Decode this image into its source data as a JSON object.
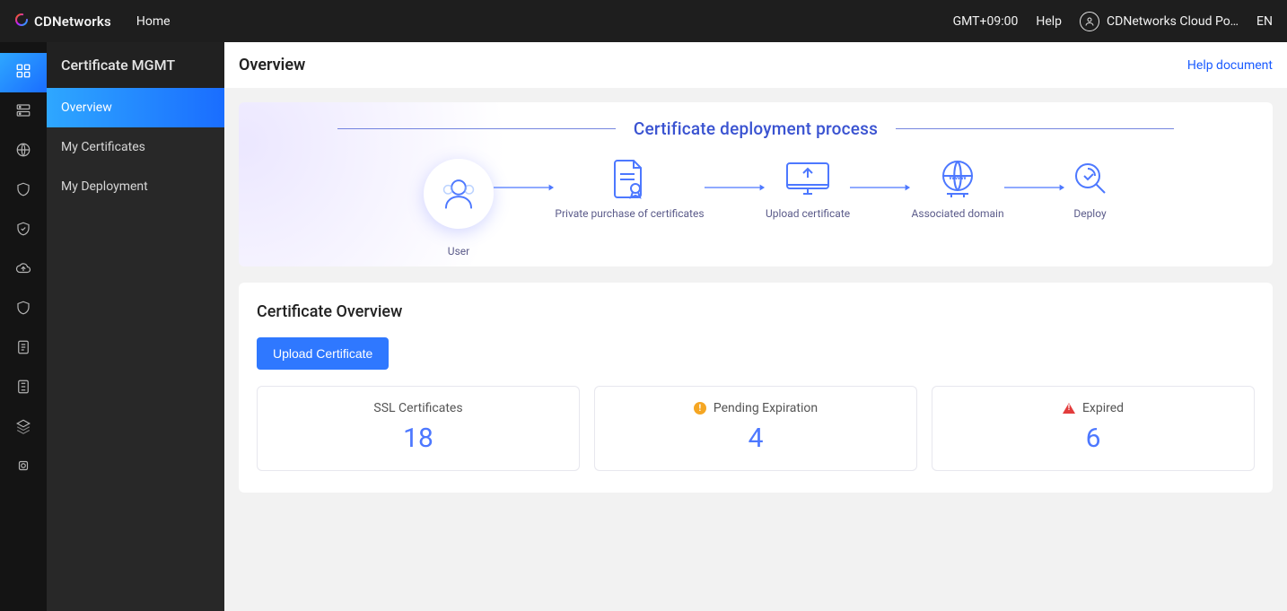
{
  "topbar": {
    "brand": "CDNetworks",
    "home": "Home",
    "timezone": "GMT+09:00",
    "help": "Help",
    "user_label": "CDNetworks Cloud Po…",
    "lang": "EN"
  },
  "sidebar": {
    "section_title": "Certificate MGMT",
    "items": [
      {
        "label": "Overview",
        "active": true
      },
      {
        "label": "My Certificates",
        "active": false
      },
      {
        "label": "My Deployment",
        "active": false
      }
    ]
  },
  "page": {
    "title": "Overview",
    "help_doc": "Help document"
  },
  "banner": {
    "title": "Certificate deployment process",
    "steps": [
      {
        "label": "User"
      },
      {
        "label": "Private purchase of certificates"
      },
      {
        "label": "Upload certificate"
      },
      {
        "label": "Associated domain"
      },
      {
        "label": "Deploy"
      }
    ]
  },
  "overview_card": {
    "title": "Certificate Overview",
    "upload_button": "Upload Certificate",
    "stats": [
      {
        "label": "SSL Certificates",
        "value": "18",
        "icon": null
      },
      {
        "label": "Pending Expiration",
        "value": "4",
        "icon": "warn"
      },
      {
        "label": "Expired",
        "value": "6",
        "icon": "error"
      }
    ]
  }
}
